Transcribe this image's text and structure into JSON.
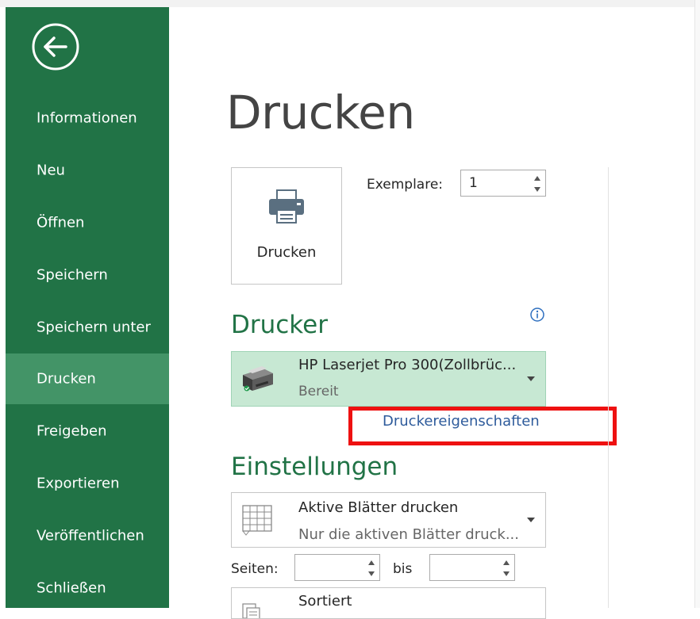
{
  "sidebar": {
    "back_icon": "back-arrow-icon",
    "items": [
      {
        "label": "Informationen"
      },
      {
        "label": "Neu"
      },
      {
        "label": "Öffnen"
      },
      {
        "label": "Speichern"
      },
      {
        "label": "Speichern unter"
      },
      {
        "label": "Drucken",
        "active": true
      },
      {
        "label": "Freigeben"
      },
      {
        "label": "Exportieren"
      },
      {
        "label": "Veröffentlichen"
      },
      {
        "label": "Schließen"
      }
    ],
    "color": "#217346",
    "active_color": "#439467"
  },
  "main": {
    "title": "Drucken",
    "print_button": {
      "label": "Drucken",
      "icon": "printer-icon"
    },
    "copies": {
      "label": "Exemplare:",
      "value": "1"
    },
    "printer_section": {
      "heading": "Drucker",
      "info_icon": "info-icon",
      "selected_printer": {
        "name": "HP Laserjet Pro 300(Zollbrüc...",
        "status": "Bereit",
        "icon": "printer-device-icon"
      },
      "properties_link": "Druckereigenschaften"
    },
    "settings_section": {
      "heading": "Einstellungen",
      "scope": {
        "title": "Aktive Blätter drucken",
        "subtitle": "Nur die aktiven Blätter druck..."
      },
      "pages": {
        "label": "Seiten:",
        "from_value": "",
        "to_label": "bis",
        "to_value": ""
      },
      "collation": {
        "title": "Sortiert"
      }
    },
    "accent_color": "#217346",
    "highlight_color": "#ee1111"
  }
}
